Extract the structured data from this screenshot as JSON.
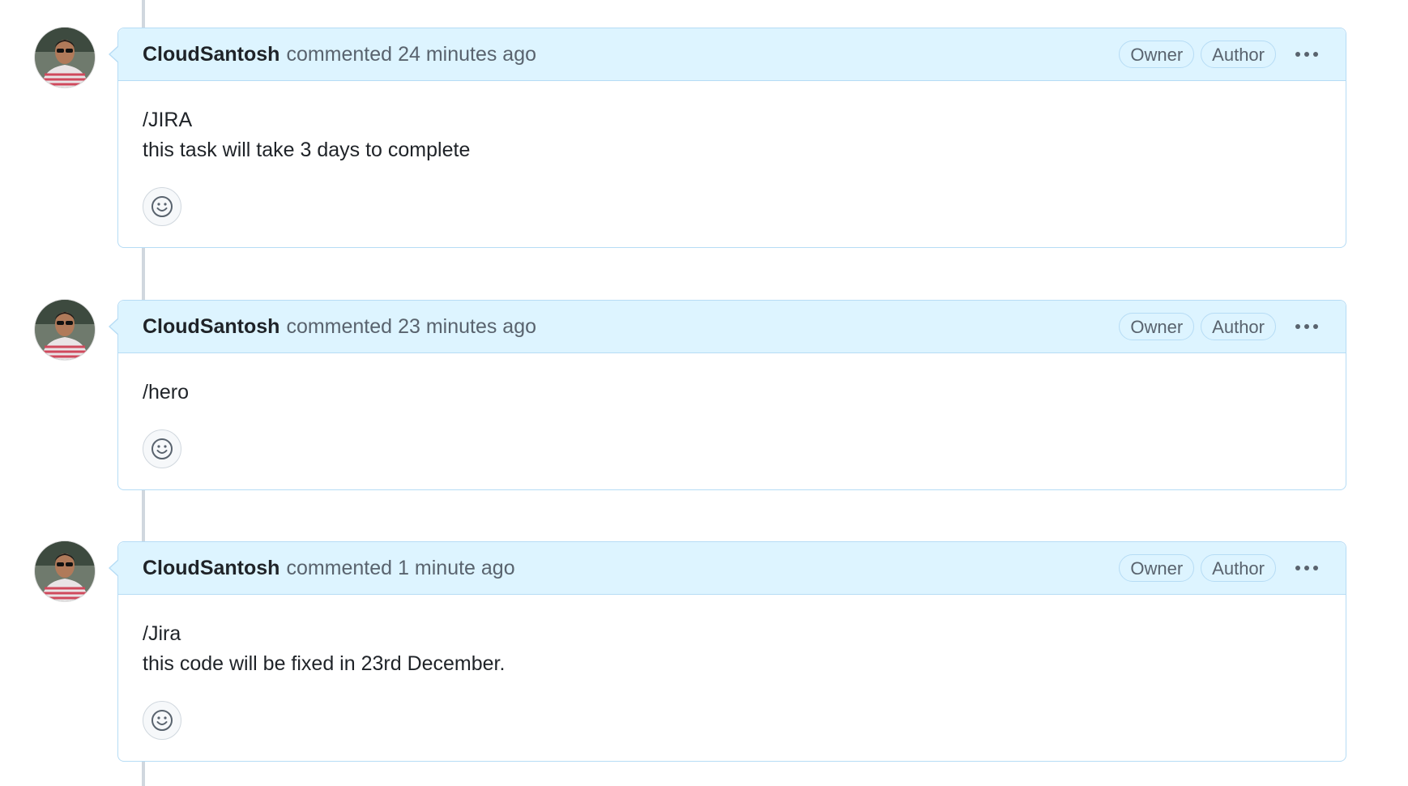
{
  "comments": [
    {
      "author": "CloudSantosh",
      "action": "commented",
      "time": "24 minutes ago",
      "badges": [
        "Owner",
        "Author"
      ],
      "body_lines": [
        "/JIRA",
        "this task will take 3 days to complete"
      ]
    },
    {
      "author": "CloudSantosh",
      "action": "commented",
      "time": "23 minutes ago",
      "badges": [
        "Owner",
        "Author"
      ],
      "body_lines": [
        "/hero"
      ]
    },
    {
      "author": "CloudSantosh",
      "action": "commented",
      "time": "1 minute ago",
      "badges": [
        "Owner",
        "Author"
      ],
      "body_lines": [
        "/Jira",
        "this code will be fixed in 23rd December."
      ]
    }
  ],
  "icons": {
    "menu": "kebab-horizontal-icon",
    "reaction": "smiley-icon"
  },
  "colors": {
    "header_bg": "#ddf4ff",
    "border": "#b6dcf5",
    "timeline": "#d0d7de",
    "muted_text": "#59636e",
    "text": "#1f2328"
  }
}
